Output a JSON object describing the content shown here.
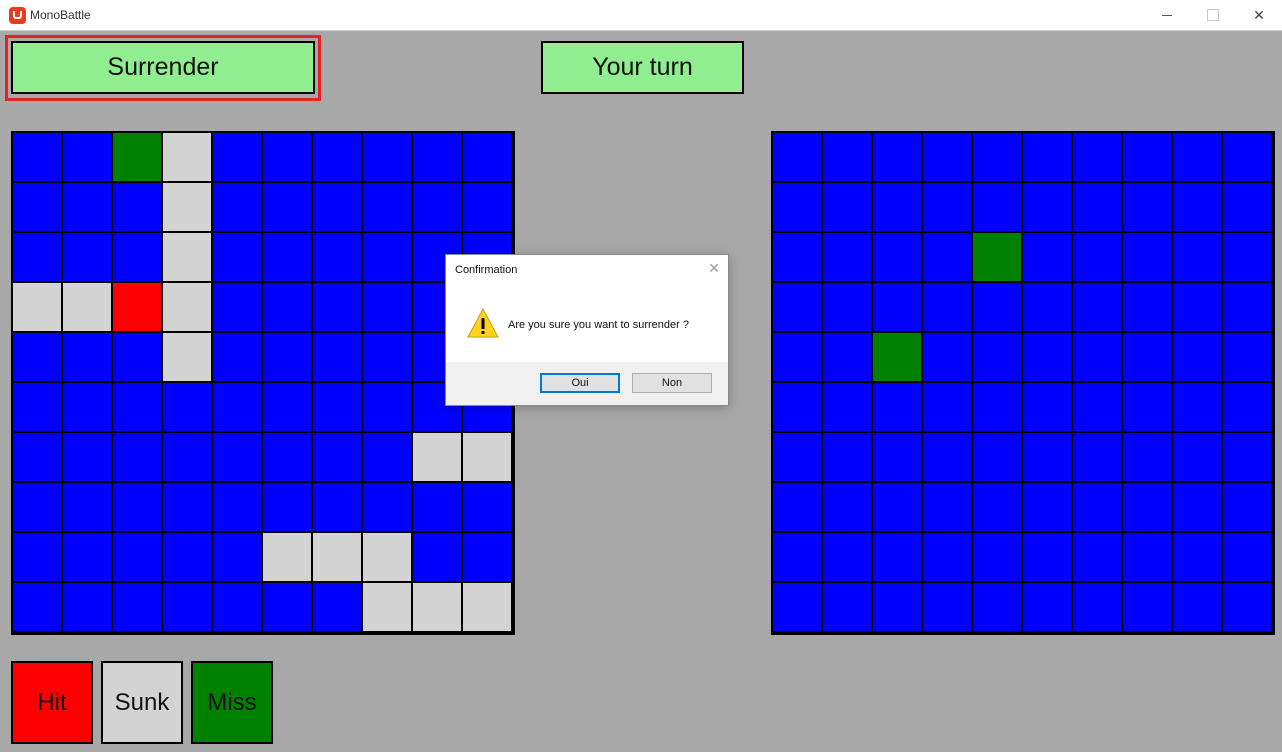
{
  "window": {
    "title": "MonoBattle",
    "minimize": "—",
    "close": "✕"
  },
  "toolbar": {
    "surrender_label": "Surrender",
    "turn_label": "Your turn"
  },
  "colors": {
    "water": "#0000ff",
    "hit": "#ff0000",
    "sunk": "#d3d3d3",
    "miss": "#008000",
    "button": "#90ee90"
  },
  "player_board": [
    "wwmswwwwww",
    "wwwswwwwww",
    "wwwswwwwww",
    "sshswwwwww",
    "wwwswwwwww",
    "wwwwwwwwww",
    "wwwwwwwwss",
    "wwwwwwwwww",
    "wwwwwsssw w",
    "wwwwwwwsss"
  ],
  "enemy_board": [
    "wwwwwwwwww",
    "wwwwwwwwww",
    "wwwwmwwwww",
    "wwwwwwwwww",
    "wwmwwwwwww",
    "wwwwwwwwww",
    "wwwwwwwwww",
    "wwwwwwwwww",
    "wwwwwwwwww",
    "wwwwwwwwww"
  ],
  "legend": {
    "hit": "Hit",
    "sunk": "Sunk",
    "miss": "Miss"
  },
  "dialog": {
    "title": "Confirmation",
    "close": "✕",
    "message": "Are you sure you want to surrender ?",
    "yes_label": "Oui",
    "no_label": "Non"
  }
}
